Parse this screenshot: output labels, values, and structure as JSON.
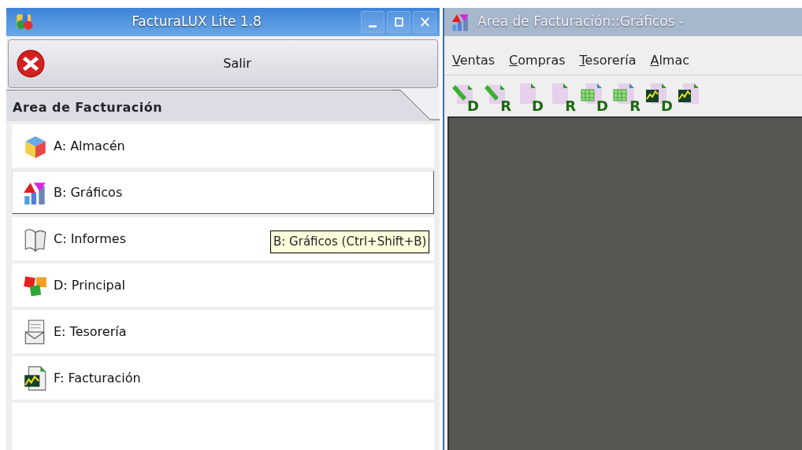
{
  "left_window": {
    "title": "FacturaLUX Lite 1.8",
    "exit_button": "Salir",
    "section_tab": "Area de Facturación",
    "items": [
      {
        "label": "A: Almacén",
        "selected": false
      },
      {
        "label": "B: Gráficos",
        "selected": true
      },
      {
        "label": "C: Informes",
        "selected": false
      },
      {
        "label": "D: Principal",
        "selected": false
      },
      {
        "label": "E: Tesorería",
        "selected": false
      },
      {
        "label": "F: Facturación",
        "selected": false
      }
    ],
    "tooltip": "B: Gráficos (Ctrl+Shift+B)"
  },
  "right_window": {
    "title": "Area de Facturación::Gráficos -",
    "menu": [
      "Ventas",
      "Compras",
      "Tesorería",
      "Almac"
    ],
    "toolbar": [
      {
        "kind": "pencil",
        "letter": "D"
      },
      {
        "kind": "pencil",
        "letter": "R"
      },
      {
        "kind": "page",
        "letter": "D"
      },
      {
        "kind": "page",
        "letter": "R"
      },
      {
        "kind": "cube",
        "letter": "D"
      },
      {
        "kind": "cube",
        "letter": "R"
      },
      {
        "kind": "chart",
        "letter": "D"
      },
      {
        "kind": "chart"
      }
    ]
  }
}
